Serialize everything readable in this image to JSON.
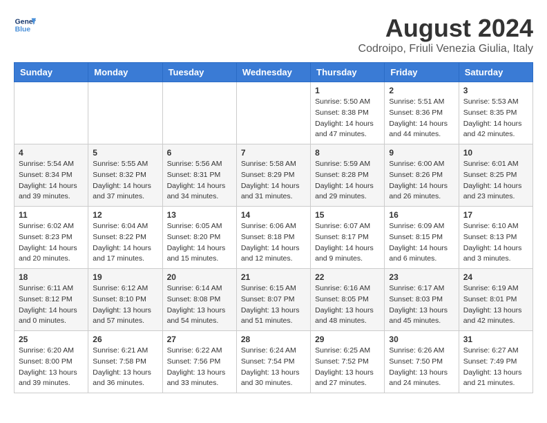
{
  "header": {
    "logo_line1": "General",
    "logo_line2": "Blue",
    "month_title": "August 2024",
    "location": "Codroipo, Friuli Venezia Giulia, Italy"
  },
  "days_of_week": [
    "Sunday",
    "Monday",
    "Tuesday",
    "Wednesday",
    "Thursday",
    "Friday",
    "Saturday"
  ],
  "weeks": [
    [
      {
        "day": "",
        "sunrise": "",
        "sunset": "",
        "daylight": ""
      },
      {
        "day": "",
        "sunrise": "",
        "sunset": "",
        "daylight": ""
      },
      {
        "day": "",
        "sunrise": "",
        "sunset": "",
        "daylight": ""
      },
      {
        "day": "",
        "sunrise": "",
        "sunset": "",
        "daylight": ""
      },
      {
        "day": "1",
        "sunrise": "Sunrise: 5:50 AM",
        "sunset": "Sunset: 8:38 PM",
        "daylight": "Daylight: 14 hours and 47 minutes."
      },
      {
        "day": "2",
        "sunrise": "Sunrise: 5:51 AM",
        "sunset": "Sunset: 8:36 PM",
        "daylight": "Daylight: 14 hours and 44 minutes."
      },
      {
        "day": "3",
        "sunrise": "Sunrise: 5:53 AM",
        "sunset": "Sunset: 8:35 PM",
        "daylight": "Daylight: 14 hours and 42 minutes."
      }
    ],
    [
      {
        "day": "4",
        "sunrise": "Sunrise: 5:54 AM",
        "sunset": "Sunset: 8:34 PM",
        "daylight": "Daylight: 14 hours and 39 minutes."
      },
      {
        "day": "5",
        "sunrise": "Sunrise: 5:55 AM",
        "sunset": "Sunset: 8:32 PM",
        "daylight": "Daylight: 14 hours and 37 minutes."
      },
      {
        "day": "6",
        "sunrise": "Sunrise: 5:56 AM",
        "sunset": "Sunset: 8:31 PM",
        "daylight": "Daylight: 14 hours and 34 minutes."
      },
      {
        "day": "7",
        "sunrise": "Sunrise: 5:58 AM",
        "sunset": "Sunset: 8:29 PM",
        "daylight": "Daylight: 14 hours and 31 minutes."
      },
      {
        "day": "8",
        "sunrise": "Sunrise: 5:59 AM",
        "sunset": "Sunset: 8:28 PM",
        "daylight": "Daylight: 14 hours and 29 minutes."
      },
      {
        "day": "9",
        "sunrise": "Sunrise: 6:00 AM",
        "sunset": "Sunset: 8:26 PM",
        "daylight": "Daylight: 14 hours and 26 minutes."
      },
      {
        "day": "10",
        "sunrise": "Sunrise: 6:01 AM",
        "sunset": "Sunset: 8:25 PM",
        "daylight": "Daylight: 14 hours and 23 minutes."
      }
    ],
    [
      {
        "day": "11",
        "sunrise": "Sunrise: 6:02 AM",
        "sunset": "Sunset: 8:23 PM",
        "daylight": "Daylight: 14 hours and 20 minutes."
      },
      {
        "day": "12",
        "sunrise": "Sunrise: 6:04 AM",
        "sunset": "Sunset: 8:22 PM",
        "daylight": "Daylight: 14 hours and 17 minutes."
      },
      {
        "day": "13",
        "sunrise": "Sunrise: 6:05 AM",
        "sunset": "Sunset: 8:20 PM",
        "daylight": "Daylight: 14 hours and 15 minutes."
      },
      {
        "day": "14",
        "sunrise": "Sunrise: 6:06 AM",
        "sunset": "Sunset: 8:18 PM",
        "daylight": "Daylight: 14 hours and 12 minutes."
      },
      {
        "day": "15",
        "sunrise": "Sunrise: 6:07 AM",
        "sunset": "Sunset: 8:17 PM",
        "daylight": "Daylight: 14 hours and 9 minutes."
      },
      {
        "day": "16",
        "sunrise": "Sunrise: 6:09 AM",
        "sunset": "Sunset: 8:15 PM",
        "daylight": "Daylight: 14 hours and 6 minutes."
      },
      {
        "day": "17",
        "sunrise": "Sunrise: 6:10 AM",
        "sunset": "Sunset: 8:13 PM",
        "daylight": "Daylight: 14 hours and 3 minutes."
      }
    ],
    [
      {
        "day": "18",
        "sunrise": "Sunrise: 6:11 AM",
        "sunset": "Sunset: 8:12 PM",
        "daylight": "Daylight: 14 hours and 0 minutes."
      },
      {
        "day": "19",
        "sunrise": "Sunrise: 6:12 AM",
        "sunset": "Sunset: 8:10 PM",
        "daylight": "Daylight: 13 hours and 57 minutes."
      },
      {
        "day": "20",
        "sunrise": "Sunrise: 6:14 AM",
        "sunset": "Sunset: 8:08 PM",
        "daylight": "Daylight: 13 hours and 54 minutes."
      },
      {
        "day": "21",
        "sunrise": "Sunrise: 6:15 AM",
        "sunset": "Sunset: 8:07 PM",
        "daylight": "Daylight: 13 hours and 51 minutes."
      },
      {
        "day": "22",
        "sunrise": "Sunrise: 6:16 AM",
        "sunset": "Sunset: 8:05 PM",
        "daylight": "Daylight: 13 hours and 48 minutes."
      },
      {
        "day": "23",
        "sunrise": "Sunrise: 6:17 AM",
        "sunset": "Sunset: 8:03 PM",
        "daylight": "Daylight: 13 hours and 45 minutes."
      },
      {
        "day": "24",
        "sunrise": "Sunrise: 6:19 AM",
        "sunset": "Sunset: 8:01 PM",
        "daylight": "Daylight: 13 hours and 42 minutes."
      }
    ],
    [
      {
        "day": "25",
        "sunrise": "Sunrise: 6:20 AM",
        "sunset": "Sunset: 8:00 PM",
        "daylight": "Daylight: 13 hours and 39 minutes."
      },
      {
        "day": "26",
        "sunrise": "Sunrise: 6:21 AM",
        "sunset": "Sunset: 7:58 PM",
        "daylight": "Daylight: 13 hours and 36 minutes."
      },
      {
        "day": "27",
        "sunrise": "Sunrise: 6:22 AM",
        "sunset": "Sunset: 7:56 PM",
        "daylight": "Daylight: 13 hours and 33 minutes."
      },
      {
        "day": "28",
        "sunrise": "Sunrise: 6:24 AM",
        "sunset": "Sunset: 7:54 PM",
        "daylight": "Daylight: 13 hours and 30 minutes."
      },
      {
        "day": "29",
        "sunrise": "Sunrise: 6:25 AM",
        "sunset": "Sunset: 7:52 PM",
        "daylight": "Daylight: 13 hours and 27 minutes."
      },
      {
        "day": "30",
        "sunrise": "Sunrise: 6:26 AM",
        "sunset": "Sunset: 7:50 PM",
        "daylight": "Daylight: 13 hours and 24 minutes."
      },
      {
        "day": "31",
        "sunrise": "Sunrise: 6:27 AM",
        "sunset": "Sunset: 7:49 PM",
        "daylight": "Daylight: 13 hours and 21 minutes."
      }
    ]
  ]
}
